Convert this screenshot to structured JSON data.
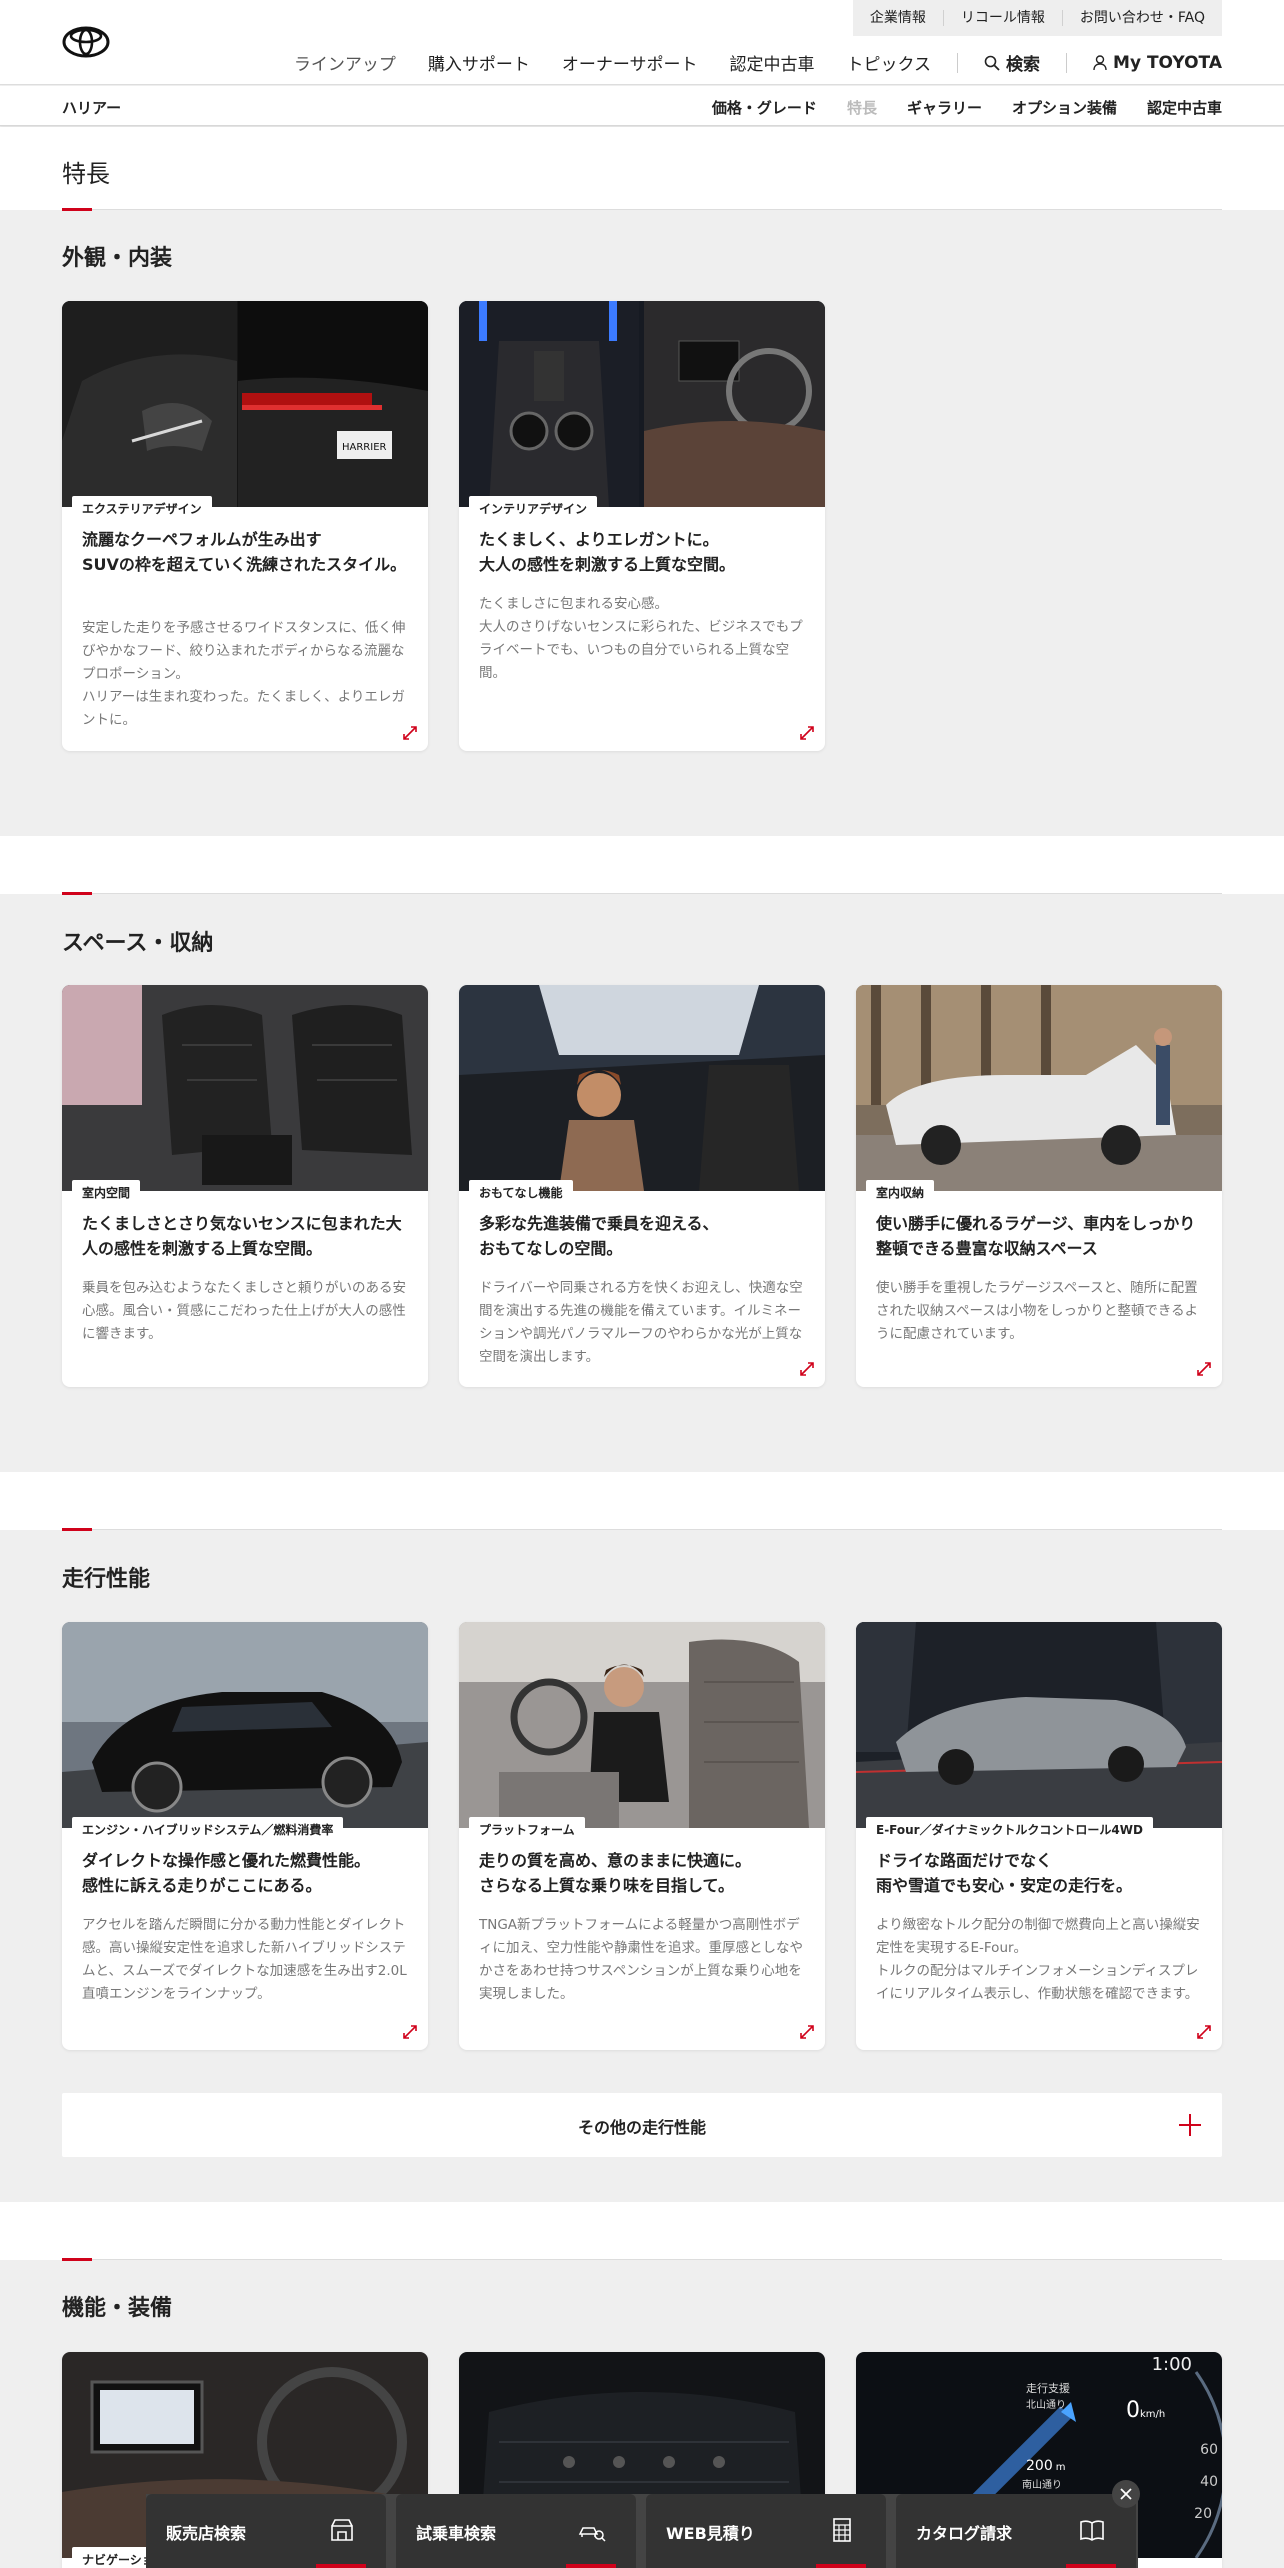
{
  "header": {
    "logo": "toyota-logo",
    "util_links": [
      "企業情報",
      "リコール情報",
      "お問い合わせ・FAQ"
    ],
    "nav_items": [
      "ラインアップ",
      "購入サポート",
      "オーナーサポート",
      "認定中古車",
      "トピックス"
    ],
    "search_label": "検索",
    "mytoyota_label": "My TOYOTA"
  },
  "subnav": {
    "model": "ハリアー",
    "links": [
      "価格・グレード",
      "特長",
      "ギャラリー",
      "オプション装備",
      "認定中古車"
    ],
    "current": "特長"
  },
  "page": {
    "title": "特長"
  },
  "sections": [
    {
      "title": "外観・内装",
      "cards": [
        {
          "tag": "エクステリアデザイン",
          "title": "流麗なクーペフォルムが生み出す\nSUVの枠を超えていく洗練されたスタイル。",
          "desc": "安定した走りを予感させるワイドスタンスに、低く伸びやかなフード、絞り込まれたボディからなる流麗なプロポーション。\nハリアーは生まれ変わった。たくましく、よりエレガントに。"
        },
        {
          "tag": "インテリアデザイン",
          "title": "たくましく、よりエレガントに。\n大人の感性を刺激する上質な空間。",
          "desc": "たくましさに包まれる安心感。\n大人のさりげないセンスに彩られた、ビジネスでもプライベートでも、いつもの自分でいられる上質な空間。"
        }
      ]
    },
    {
      "title": "スペース・収納",
      "cards": [
        {
          "tag": "室内空間",
          "title": "たくましさとさり気ないセンスに包まれた大人の感性を刺激する上質な空間。",
          "desc": "乗員を包み込むようなたくましさと頼りがいのある安心感。風合い・質感にこだわった仕上げが大人の感性に響きます。"
        },
        {
          "tag": "おもてなし機能",
          "title": "多彩な先進装備で乗員を迎える、\nおもてなしの空間。",
          "desc": "ドライバーや同乗される方を快くお迎えし、快適な空間を演出する先進の機能を備えています。イルミネーションや調光パノラマルーフのやわらかな光が上質な空間を演出します。"
        },
        {
          "tag": "室内収納",
          "title": "使い勝手に優れるラゲージ、車内をしっかり整頓できる豊富な収納スペース",
          "desc": "使い勝手を重視したラゲージスペースと、随所に配置された収納スペースは小物をしっかりと整頓できるように配慮されています。"
        }
      ]
    },
    {
      "title": "走行性能",
      "cards": [
        {
          "tag": "エンジン・ハイブリッドシステム／燃料消費率",
          "title": "ダイレクトな操作感と優れた燃費性能。\n感性に訴える走りがここにある。",
          "desc": "アクセルを踏んだ瞬間に分かる動力性能とダイレクト感。高い操縦安定性を追求した新ハイブリッドシステムと、スムーズでダイレクトな加速感を生み出す2.0L直噴エンジンをラインナップ。"
        },
        {
          "tag": "プラットフォーム",
          "title": "走りの質を高め、意のままに快適に。\nさらなる上質な乗り味を目指して。",
          "desc": "TNGA新プラットフォームによる軽量かつ高剛性ボディに加え、空力性能や静粛性を追求。重厚感としなやかさをあわせ持つサスペンションが上質な乗り心地を実現しました。"
        },
        {
          "tag": "E-Four／ダイナミックトルクコントロール4WD",
          "title": "ドライな路面だけでなく\n雨や雪道でも安心・安定の走行を。",
          "desc": "より緻密なトルク配分の制御で燃費向上と高い操縦安定性を実現するE-Four。\nトルクの配分はマルチインフォメーションディスプレイにリアルタイム表示し、作動状態を確認できます。"
        }
      ],
      "more_label": "その他の走行性能"
    },
    {
      "title": "機能・装備",
      "cards": [
        {
          "tag": "ナビゲーション"
        }
      ],
      "meter": {
        "time": "1:00",
        "drive_label": "走行支援",
        "street": "北山通り",
        "speed": "0",
        "speed_unit": "km/h",
        "distance": "200",
        "distance_unit": "m",
        "street2": "南山通り",
        "ticks": [
          "60",
          "40",
          "20"
        ]
      }
    }
  ],
  "footer_bar": {
    "buttons": [
      "販売店検索",
      "試乗車検索",
      "WEB見積り",
      "カタログ請求"
    ]
  },
  "colors": {
    "accent": "#d0021b",
    "bg": "#efefef"
  }
}
